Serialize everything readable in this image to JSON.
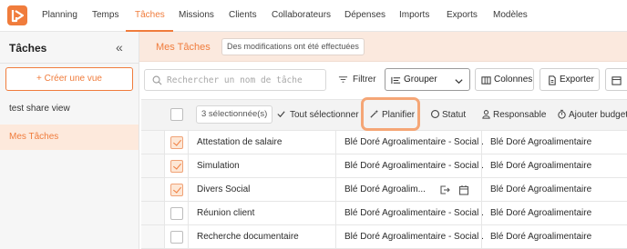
{
  "nav": {
    "items": [
      "Planning",
      "Temps",
      "Tâches",
      "Missions",
      "Clients",
      "Collaborateurs",
      "Dépenses",
      "Imports",
      "Exports",
      "Modèles"
    ],
    "active": "Tâches"
  },
  "sidebar": {
    "title": "Tâches",
    "collapse_icon": "«",
    "create_label": "+ Créer une vue",
    "items": [
      {
        "label": "test share view",
        "active": false
      },
      {
        "label": "Mes Tâches",
        "active": true
      }
    ]
  },
  "header": {
    "title": "Mes Tâches",
    "status": "Des modifications ont été effectuées"
  },
  "toolbar": {
    "search_placeholder": "Rechercher un nom de tâche",
    "filter_label": "Filtrer",
    "group_label": "Grouper",
    "columns_label": "Colonnes",
    "export_label": "Exporter"
  },
  "selection": {
    "count_label": "3 sélectionnée(s)",
    "select_all_label": "Tout sélectionner",
    "actions": [
      "Planifier",
      "Statut",
      "Responsable",
      "Ajouter budget"
    ]
  },
  "table": {
    "rows": [
      {
        "checked": true,
        "name": "Attestation de salaire",
        "client": "Blé Doré Agroalimentaire - Social ...",
        "company": "Blé Doré Agroalimentaire"
      },
      {
        "checked": true,
        "name": "Simulation",
        "client": "Blé Doré Agroalimentaire - Social ...",
        "company": "Blé Doré Agroalimentaire"
      },
      {
        "checked": true,
        "name": "Divers Social",
        "client": "Blé Doré Agroalim...",
        "company": "Blé Doré Agroalimentaire"
      },
      {
        "checked": false,
        "name": "Réunion client",
        "client": "Blé Doré Agroalimentaire - Social ...",
        "company": "Blé Doré Agroalimentaire"
      },
      {
        "checked": false,
        "name": "Recherche documentaire",
        "client": "Blé Doré Agroalimentaire - Social ...",
        "company": "Blé Doré Agroalimentaire"
      }
    ]
  },
  "colors": {
    "accent": "#f07c3c",
    "accent_light": "#fbe9de"
  }
}
